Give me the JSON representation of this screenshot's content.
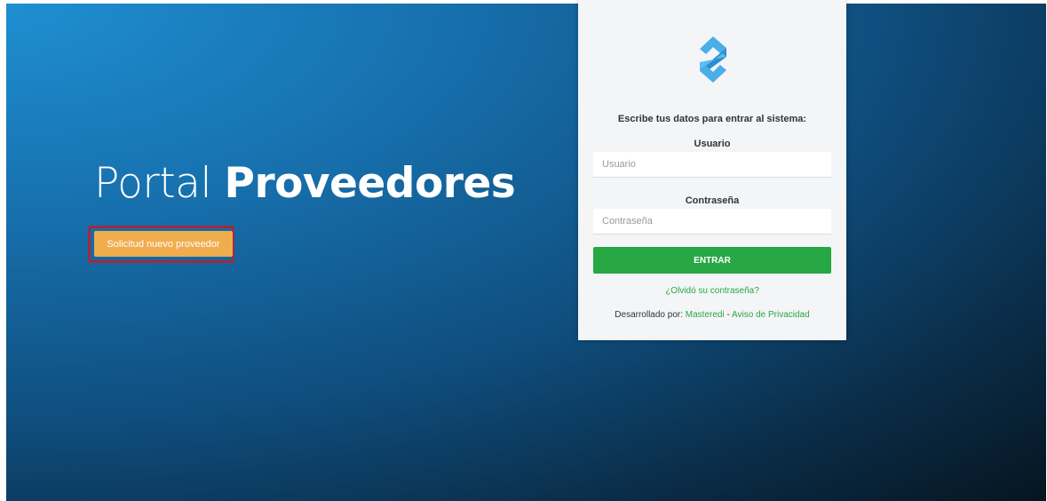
{
  "hero": {
    "title_light": "Portal",
    "title_bold": "Proveedores",
    "cta_label": "Solicitud nuevo proveedor"
  },
  "login": {
    "instructions": "Escribe tus datos para entrar al sistema:",
    "username_label": "Usuario",
    "username_placeholder": "Usuario",
    "password_label": "Contraseña",
    "password_placeholder": "Contraseña",
    "submit_label": "ENTRAR",
    "forgot_label": "¿Olvidó su contraseña?",
    "footer_prefix": "Desarrollado por: ",
    "developer_link": "Masteredi",
    "footer_separator": " - ",
    "privacy_link": "Aviso de Privacidad"
  },
  "colors": {
    "accent_green": "#28a745",
    "cta_orange": "#f0ad4e",
    "highlight_border": "#a02b3e",
    "logo_blue": "#4aaee8"
  },
  "icons": {
    "logo": "brand-logo-icon"
  }
}
